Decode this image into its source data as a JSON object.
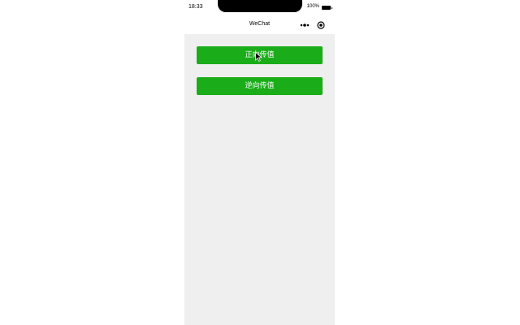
{
  "status_bar": {
    "time": "18:33",
    "battery_percent": "100%"
  },
  "nav": {
    "title": "WeChat",
    "menu_icon": "more-dots-icon",
    "close_icon": "close-target-icon"
  },
  "buttons": {
    "forward_label": "正向传值",
    "reverse_label": "逆向传值"
  },
  "colors": {
    "button_green": "#1aad19",
    "page_background": "#efefef"
  },
  "cursor_icon": "mouse-pointer-icon"
}
